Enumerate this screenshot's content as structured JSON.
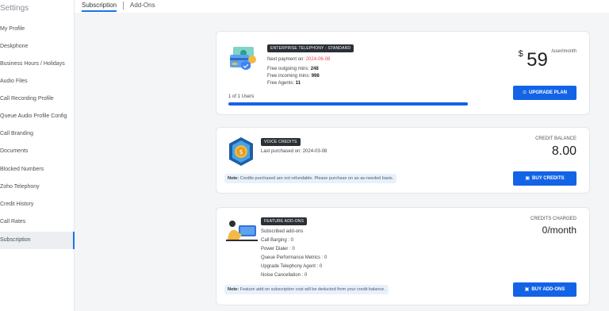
{
  "sidebar": {
    "title": "Settings",
    "items": [
      {
        "label": "My Profile"
      },
      {
        "label": "Deskphone"
      },
      {
        "label": "Business Hours / Holidays"
      },
      {
        "label": "Audio Files"
      },
      {
        "label": "Call Recording Profile"
      },
      {
        "label": "Queue Audio Profile Config"
      },
      {
        "label": "Call Branding"
      },
      {
        "label": "Documents"
      },
      {
        "label": "Blocked Numbers"
      },
      {
        "label": "Zoho Telephony"
      },
      {
        "label": "Credit History"
      },
      {
        "label": "Call Rates"
      },
      {
        "label": "Subscription"
      }
    ],
    "active": "Subscription"
  },
  "tabs": [
    {
      "label": "Subscription"
    },
    {
      "label": "Add-Ons"
    }
  ],
  "plan": {
    "badge": "ENTERPRISE TELEPHONY - STANDARD",
    "next_payment_label": "Next payment on:",
    "next_payment_date": "2024-06-08",
    "outgoing_label": "Free outgoing mins:",
    "outgoing_value": "248",
    "incoming_label": "Free incoming mins:",
    "incoming_value": "998",
    "agents_label": "Free Agents:",
    "agents_value": "11",
    "users_text": "1 of 1 Users",
    "users_progress": 1.0,
    "currency": "$",
    "price": "59",
    "price_unit": "/user/month",
    "upgrade_label": "UPGRADE PLAN"
  },
  "credits": {
    "badge": "VOICE CREDITS",
    "last_purchased": "Last purchased on: 2024-03-08",
    "balance_label": "CREDIT BALANCE",
    "balance_value": "8.00",
    "note_prefix": "Note:",
    "note_text": "Credits purchased are not refundable. Please purchase on an as-needed basis.",
    "buy_label": "BUY CREDITS"
  },
  "addons": {
    "badge": "FEATURE ADD-ONS",
    "subscribed_label": "Subscribed add-ons",
    "items": [
      "Call Barging : 0",
      "Power Dialer : 0",
      "Queue Performance Metrics : 0",
      "Upgrade Telephony Agent : 0",
      "Noise Cancellation : 0"
    ],
    "charged_label": "CREDITS CHARGED",
    "charged_value": "0/month",
    "note_prefix": "Note:",
    "note_text": "Feature add-on subscription cost will be deducted from your credit balance.",
    "buy_label": "BUY ADD-ONS"
  },
  "colors": {
    "accent": "#1363e6",
    "badge_bg": "#2b2f36",
    "next_payment": "#e34b4b",
    "note_bg": "#e8f1fb"
  }
}
